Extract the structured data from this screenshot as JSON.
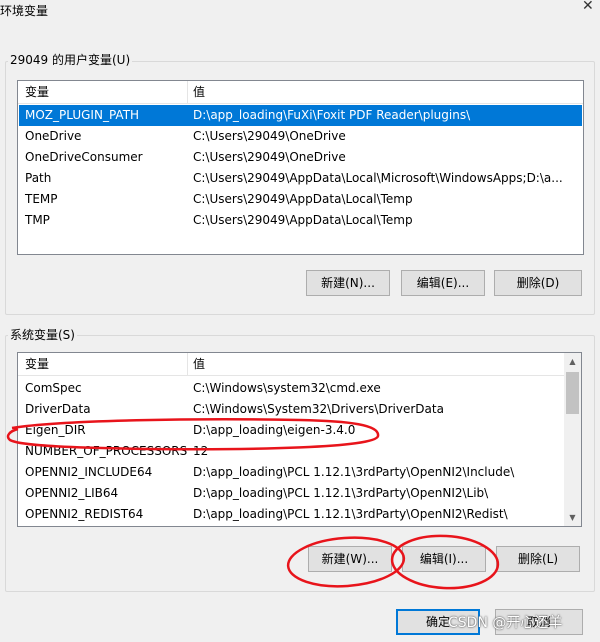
{
  "window": {
    "title": "环境变量"
  },
  "user_vars": {
    "group_label": "29049 的用户变量(U)",
    "headers": {
      "name": "变量",
      "value": "值"
    },
    "rows": [
      {
        "name": "MOZ_PLUGIN_PATH",
        "value": "D:\\app_loading\\FuXi\\Foxit PDF Reader\\plugins\\"
      },
      {
        "name": "OneDrive",
        "value": "C:\\Users\\29049\\OneDrive"
      },
      {
        "name": "OneDriveConsumer",
        "value": "C:\\Users\\29049\\OneDrive"
      },
      {
        "name": "Path",
        "value": "C:\\Users\\29049\\AppData\\Local\\Microsoft\\WindowsApps;D:\\a..."
      },
      {
        "name": "TEMP",
        "value": "C:\\Users\\29049\\AppData\\Local\\Temp"
      },
      {
        "name": "TMP",
        "value": "C:\\Users\\29049\\AppData\\Local\\Temp"
      }
    ],
    "buttons": {
      "new": "新建(N)...",
      "edit": "编辑(E)...",
      "delete": "删除(D)"
    }
  },
  "system_vars": {
    "group_label": "系统变量(S)",
    "headers": {
      "name": "变量",
      "value": "值"
    },
    "rows": [
      {
        "name": "ComSpec",
        "value": "C:\\Windows\\system32\\cmd.exe"
      },
      {
        "name": "DriverData",
        "value": "C:\\Windows\\System32\\Drivers\\DriverData"
      },
      {
        "name": "Eigen_DIR",
        "value": "D:\\app_loading\\eigen-3.4.0"
      },
      {
        "name": "NUMBER_OF_PROCESSORS",
        "value": "12"
      },
      {
        "name": "OPENNI2_INCLUDE64",
        "value": "D:\\app_loading\\PCL 1.12.1\\3rdParty\\OpenNI2\\Include\\"
      },
      {
        "name": "OPENNI2_LIB64",
        "value": "D:\\app_loading\\PCL 1.12.1\\3rdParty\\OpenNI2\\Lib\\"
      },
      {
        "name": "OPENNI2_REDIST64",
        "value": "D:\\app_loading\\PCL 1.12.1\\3rdParty\\OpenNI2\\Redist\\"
      }
    ],
    "buttons": {
      "new": "新建(W)...",
      "edit": "编辑(I)...",
      "delete": "删除(L)"
    }
  },
  "footer": {
    "ok": "确定",
    "cancel": "取消"
  },
  "watermark": "CSDN @开心还羊",
  "icons": {
    "close": "close-icon",
    "scroll_up": "chevron-up-icon",
    "scroll_down": "chevron-down-icon"
  },
  "colors": {
    "selection": "#0078d7",
    "annotation": "#e8141b"
  }
}
